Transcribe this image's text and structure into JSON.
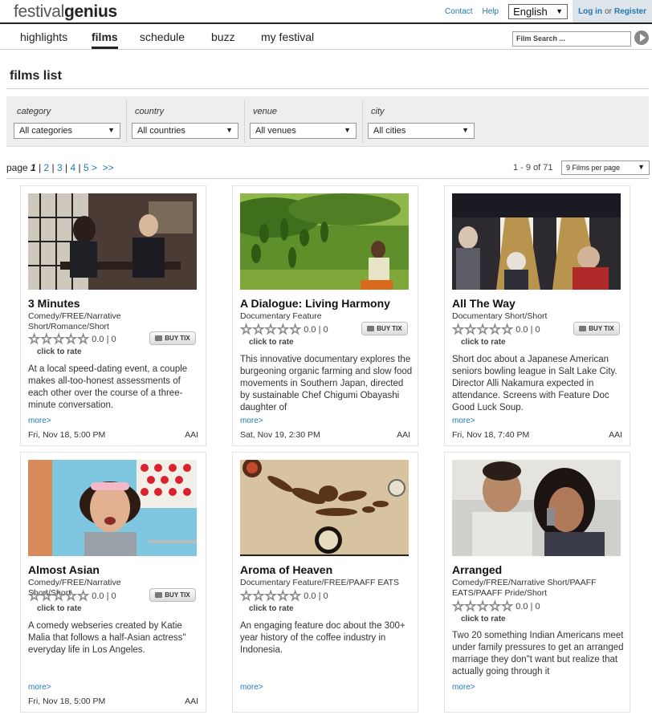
{
  "header": {
    "logo_light": "festival",
    "logo_bold": "genius",
    "links": {
      "contact": "Contact",
      "help": "Help"
    },
    "language": "English",
    "login": "Log in",
    "or": "or",
    "register": "Register"
  },
  "nav": {
    "items": [
      "highlights",
      "films",
      "schedule",
      "buzz",
      "my festival"
    ],
    "active": "films",
    "search_placeholder": "Film Search ..."
  },
  "page": {
    "title": "films list"
  },
  "filters": [
    {
      "label": "category",
      "value": "All categories"
    },
    {
      "label": "country",
      "value": "All countries"
    },
    {
      "label": "venue",
      "value": "All venues"
    },
    {
      "label": "city",
      "value": "All cities"
    }
  ],
  "pager": {
    "prefix": "page",
    "current": "1",
    "pages": [
      "2",
      "3",
      "4",
      "5 >"
    ],
    "last": ">>",
    "count": "1 - 9 of 71",
    "per_page": "9 Films per page"
  },
  "films": [
    {
      "title": "3 Minutes",
      "genre": "Comedy/FREE/Narrative Short/Romance/Short",
      "rating": "0.0 | 0",
      "rate_label": "click to rate",
      "buy": "BUY TIX",
      "has_buy": true,
      "description": "At a local speed-dating event, a couple makes all-too-honest assessments of each other over the course of a three-minute conversation.",
      "more": "more>",
      "datetime": "Fri, Nov 18, 5:00 PM",
      "venue": "AAI"
    },
    {
      "title": "A Dialogue: Living Harmony",
      "genre": "Documentary Feature",
      "rating": "0.0 | 0",
      "rate_label": "click to rate",
      "buy": "BUY TIX",
      "has_buy": true,
      "description": "This innovative documentary explores the burgeoning organic farming and slow food movements in Southern Japan, directed by sustainable Chef Chigumi Obayashi daughter of",
      "more": "more>",
      "datetime": "Sat, Nov 19, 2:30 PM",
      "venue": "AAI"
    },
    {
      "title": "All The Way",
      "genre": "Documentary Short/Short",
      "rating": "0.0 | 0",
      "rate_label": "click to rate",
      "buy": "BUY TIX",
      "has_buy": true,
      "description": "Short doc about a Japanese American seniors bowling league in Salt Lake City. Director Alli Nakamura expected in attendance. Screens with Feature Doc Good Luck Soup.",
      "more": "more>",
      "datetime": "Fri, Nov 18, 7:40 PM",
      "venue": "AAI"
    },
    {
      "title": "Almost Asian",
      "genre": "Comedy/FREE/Narrative Short/Short",
      "rating": "0.0 | 0",
      "rate_label": "click to rate",
      "buy": "BUY TIX",
      "has_buy": true,
      "description": "A comedy webseries created by Katie Malia that follows a half-Asian actress\" everyday life in Los Angeles.",
      "more": "more>",
      "datetime": "Fri, Nov 18, 5:00 PM",
      "venue": "AAI"
    },
    {
      "title": "Aroma of Heaven",
      "genre": "Documentary Feature/FREE/PAAFF EATS",
      "rating": "0.0 | 0",
      "rate_label": "click to rate",
      "buy": "",
      "has_buy": false,
      "description": "An engaging feature doc about the 300+ year history of the coffee industry in Indonesia.",
      "more": "more>",
      "datetime": "",
      "venue": ""
    },
    {
      "title": "Arranged",
      "genre": "Comedy/FREE/Narrative Short/PAAFF EATS/PAAFF Pride/Short",
      "rating": "0.0 | 0",
      "rate_label": "click to rate",
      "buy": "",
      "has_buy": false,
      "description": "Two 20 something Indian Americans meet under family pressures to get an arranged marriage they don\"t want but realize that actually going through it",
      "more": "more>",
      "datetime": "",
      "venue": ""
    }
  ]
}
